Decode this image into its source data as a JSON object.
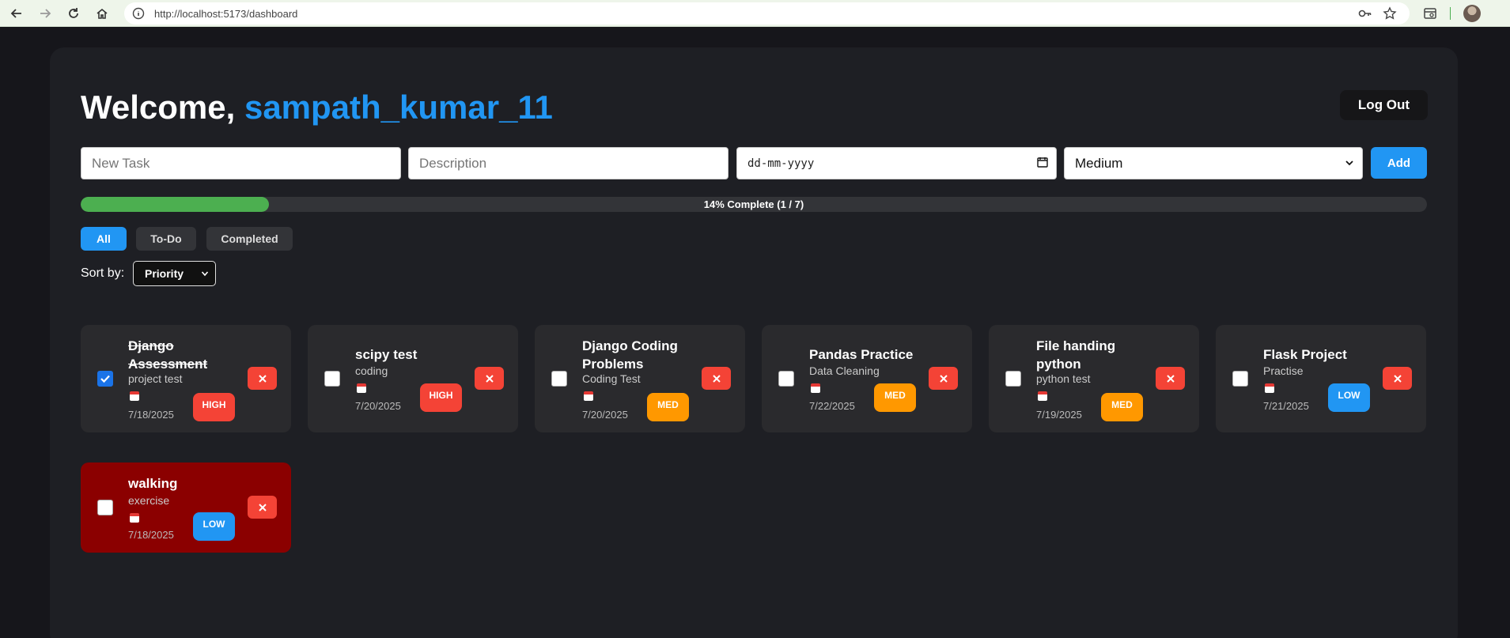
{
  "browser": {
    "url": "http://localhost:5173/dashboard"
  },
  "header": {
    "welcome_prefix": "Welcome, ",
    "username": "sampath_kumar_11",
    "logout_label": "Log Out"
  },
  "form": {
    "task_placeholder": "New Task",
    "description_placeholder": "Description",
    "date_placeholder": "dd-mm-yyyy",
    "priority_value": "Medium",
    "add_label": "Add"
  },
  "progress": {
    "percent": 14,
    "label": "14% Complete (1 / 7)"
  },
  "filters": [
    {
      "label": "All",
      "active": true
    },
    {
      "label": "To-Do",
      "active": false
    },
    {
      "label": "Completed",
      "active": false
    }
  ],
  "sort": {
    "label": "Sort by:",
    "value": "Priority"
  },
  "tasks": [
    {
      "title": "Django Assessment",
      "description": "project test",
      "date": "7/18/2025",
      "priority": "HIGH",
      "completed": true
    },
    {
      "title": "scipy test",
      "description": "coding",
      "date": "7/20/2025",
      "priority": "HIGH",
      "completed": false
    },
    {
      "title": "Django Coding Problems",
      "description": "Coding Test",
      "date": "7/20/2025",
      "priority": "MED",
      "completed": false
    },
    {
      "title": "Pandas Practice",
      "description": "Data Cleaning",
      "date": "7/22/2025",
      "priority": "MED",
      "completed": false
    },
    {
      "title": "File handing python",
      "description": "python test",
      "date": "7/19/2025",
      "priority": "MED",
      "completed": false
    },
    {
      "title": "Flask Project",
      "description": "Practise",
      "date": "7/21/2025",
      "priority": "LOW",
      "completed": false
    },
    {
      "title": "walking",
      "description": "exercise",
      "date": "7/18/2025",
      "priority": "LOW",
      "completed": false,
      "overdue": true
    }
  ],
  "colors": {
    "accent": "#2196f3",
    "progress": "#4caf50",
    "high": "#f44336",
    "med": "#ff9800",
    "low": "#2196f3",
    "overdue": "#8b0000"
  }
}
